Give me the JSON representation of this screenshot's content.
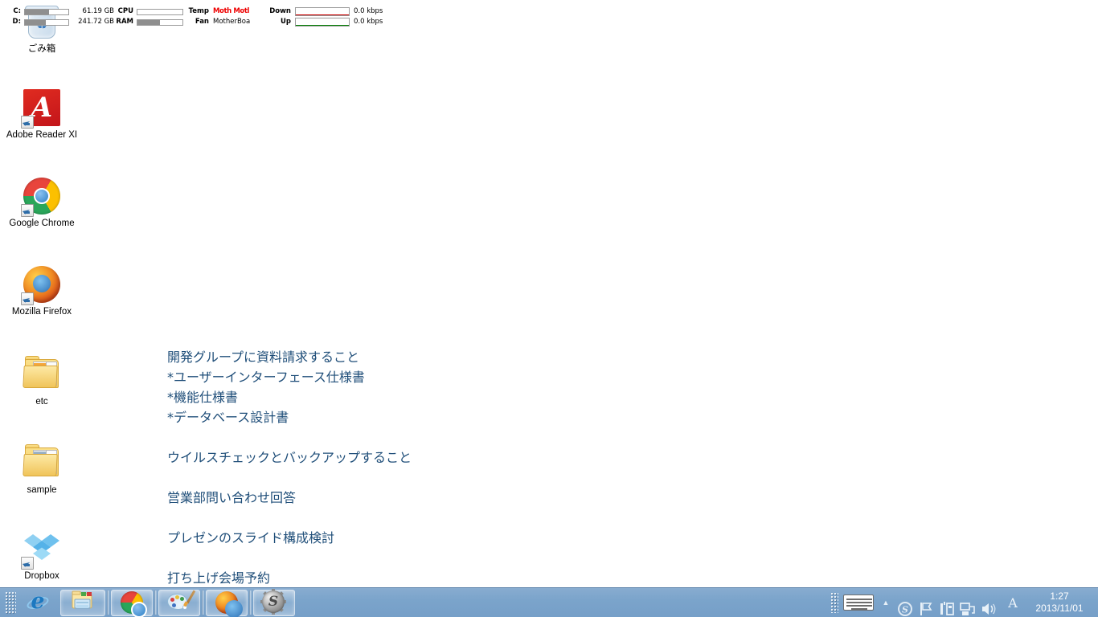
{
  "system_monitor": {
    "disk": [
      {
        "label": "C:",
        "value": "61.19 GB",
        "fill_percent": 55
      },
      {
        "label": "D:",
        "value": "241.72 GB",
        "fill_percent": 48
      }
    ],
    "cpu": {
      "label": "CPU",
      "fill_percent": 0
    },
    "ram": {
      "label": "RAM",
      "fill_percent": 50
    },
    "temp": {
      "label": "Temp",
      "value": "Moth Motl",
      "color": "#ee0000"
    },
    "fan": {
      "label": "Fan",
      "value": "MotherBoa",
      "color": "#000000"
    },
    "network": [
      {
        "label": "Down",
        "value": "0.0 kbps",
        "line_color": "#cc0000"
      },
      {
        "label": "Up",
        "value": "0.0 kbps",
        "line_color": "#008000"
      }
    ]
  },
  "desktop_icons": [
    {
      "name": "recycle-bin",
      "label": "ごみ箱",
      "icon": "recycle-bin-icon",
      "shortcut": false
    },
    {
      "name": "adobe-reader",
      "label": "Adobe Reader XI",
      "icon": "adobe-reader-icon",
      "shortcut": true
    },
    {
      "name": "google-chrome",
      "label": "Google Chrome",
      "icon": "chrome-icon",
      "shortcut": true
    },
    {
      "name": "mozilla-firefox",
      "label": "Mozilla Firefox",
      "icon": "firefox-icon",
      "shortcut": true
    },
    {
      "name": "folder-etc",
      "label": "etc",
      "icon": "folder-icon",
      "shortcut": false
    },
    {
      "name": "folder-sample",
      "label": "sample",
      "icon": "folder-icon",
      "shortcut": false
    },
    {
      "name": "dropbox",
      "label": "Dropbox",
      "icon": "dropbox-icon",
      "shortcut": true
    }
  ],
  "notes": {
    "color": "#1f4e79",
    "lines": [
      "開発グループに資料請求すること",
      "*ユーザーインターフェース仕様書",
      "*機能仕様書",
      "*データベース設計書",
      "",
      "ウイルスチェックとバックアップすること",
      "",
      "営業部問い合わせ回答",
      "",
      "プレゼンのスライド構成検討",
      "",
      "打ち上げ会場予約"
    ]
  },
  "taskbar": {
    "background": "#7ba4cb",
    "buttons": [
      {
        "name": "internet-explorer",
        "label": "Internet Explorer",
        "icon": "internet-explorer-icon",
        "active": false
      },
      {
        "name": "windows-explorer",
        "label": "エクスプローラー",
        "icon": "folder-explorer-icon",
        "active": true
      },
      {
        "name": "google-chrome",
        "label": "Google Chrome",
        "icon": "chrome-icon",
        "active": true
      },
      {
        "name": "paint",
        "label": "ペイント",
        "icon": "paint-palette-icon",
        "active": true
      },
      {
        "name": "mozilla-firefox",
        "label": "Mozilla Firefox",
        "icon": "firefox-icon",
        "active": true
      },
      {
        "name": "sandboxie",
        "label": "Sandboxie",
        "icon": "sandboxie-gear-icon",
        "active": true
      }
    ],
    "tray": {
      "ime_keyboard": "ime-keyboard-icon",
      "show_hidden": "chevron-up-icon",
      "icons": [
        {
          "name": "sandboxie-tray",
          "icon": "sandboxie-gear-icon"
        },
        {
          "name": "action-center",
          "icon": "flag-icon"
        },
        {
          "name": "device-manager",
          "icon": "usb-device-icon"
        },
        {
          "name": "network",
          "icon": "network-icon"
        },
        {
          "name": "volume",
          "icon": "speaker-icon"
        }
      ],
      "ime_mode": "A",
      "clock": {
        "time": "1:27",
        "date": "2013/11/01"
      }
    }
  }
}
